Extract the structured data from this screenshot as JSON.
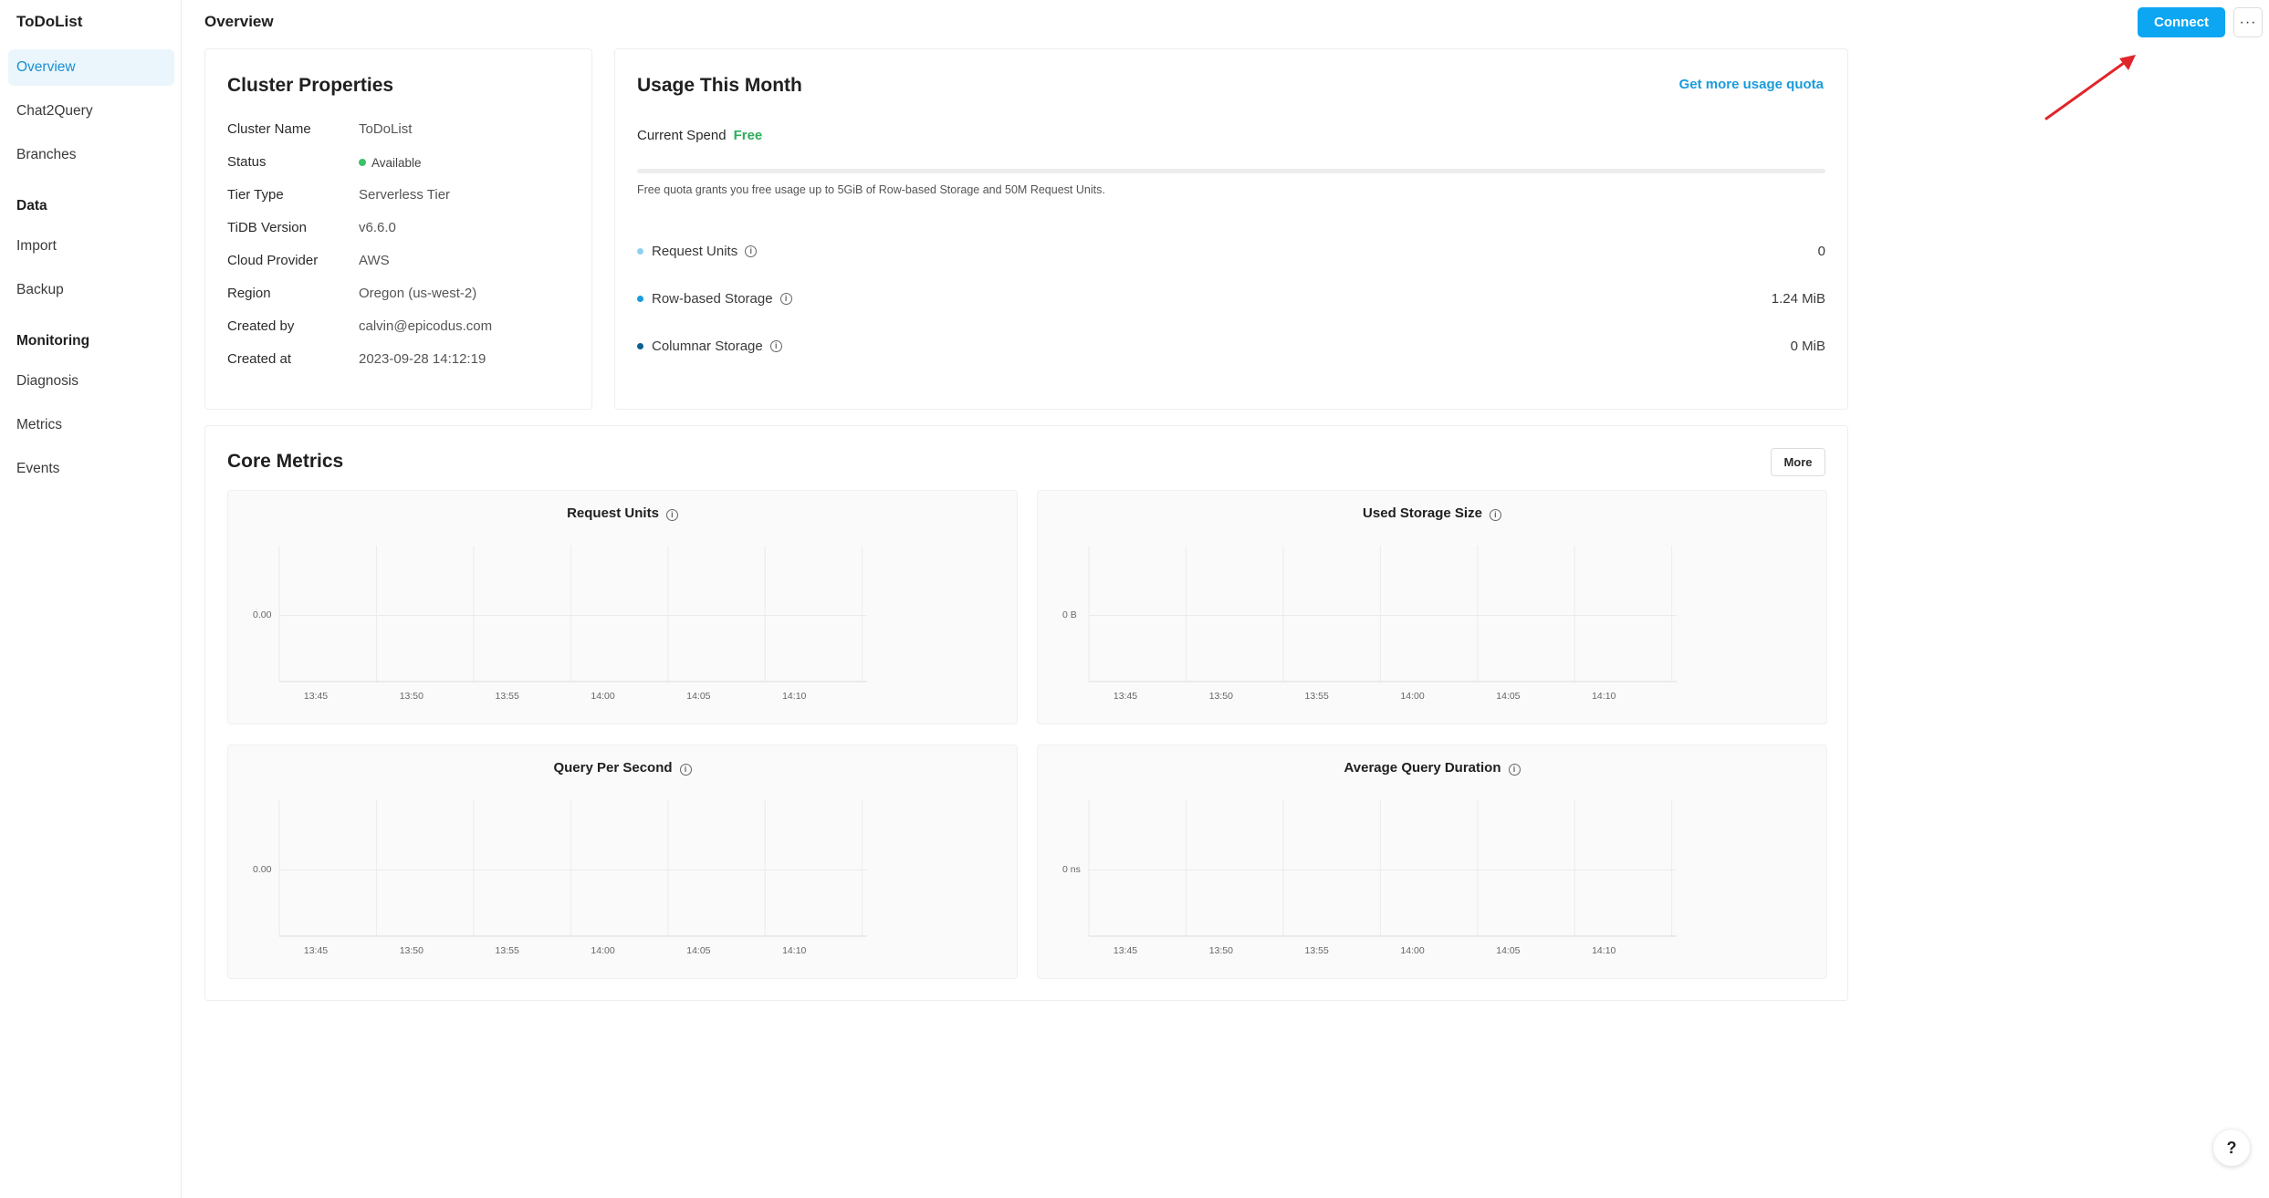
{
  "sidebar": {
    "app_title": "ToDoList",
    "items_top": [
      {
        "label": "Overview",
        "active": true
      },
      {
        "label": "Chat2Query"
      },
      {
        "label": "Branches"
      }
    ],
    "sections": [
      {
        "title": "Data",
        "items": [
          {
            "label": "Import"
          },
          {
            "label": "Backup"
          }
        ]
      },
      {
        "title": "Monitoring",
        "items": [
          {
            "label": "Diagnosis"
          },
          {
            "label": "Metrics"
          },
          {
            "label": "Events"
          }
        ]
      }
    ]
  },
  "header": {
    "title": "Overview",
    "connect_label": "Connect",
    "more_label": "···",
    "accent": "#0ca6f2"
  },
  "cluster": {
    "title": "Cluster Properties",
    "props": [
      {
        "label": "Cluster Name",
        "value": "ToDoList"
      },
      {
        "label": "Status",
        "value": "Available"
      },
      {
        "label": "Tier Type",
        "value": "Serverless Tier"
      },
      {
        "label": "TiDB Version",
        "value": "v6.6.0"
      },
      {
        "label": "Cloud Provider",
        "value": "AWS"
      },
      {
        "label": "Region",
        "value": "Oregon (us-west-2)"
      },
      {
        "label": "Created by",
        "value": "calvin@epicodus.com"
      },
      {
        "label": "Created at",
        "value": "2023-09-28 14:12:19"
      }
    ],
    "status_color": "#3dbf6b"
  },
  "usage": {
    "title": "Usage This Month",
    "quota_link": "Get more usage quota",
    "spend_label": "Current Spend",
    "spend_value": "Free",
    "progress_fraction": 0.0,
    "note": "Free quota grants you free usage up to 5GiB of Row-based Storage and 50M Request Units.",
    "rows": [
      {
        "label": "Request Units",
        "value": "0",
        "color": "#8fd0f2"
      },
      {
        "label": "Row-based Storage",
        "value": "1.24 MiB",
        "color": "#1a9bdc"
      },
      {
        "label": "Columnar Storage",
        "value": "0 MiB",
        "color": "#0b5f93"
      }
    ]
  },
  "metrics": {
    "title": "Core Metrics",
    "more_label": "More"
  },
  "chart_data": [
    {
      "type": "line",
      "title": "Request Units",
      "x": [
        "13:45",
        "13:50",
        "13:55",
        "14:00",
        "14:05",
        "14:10"
      ],
      "ytick": "0.00",
      "series": []
    },
    {
      "type": "line",
      "title": "Used Storage Size",
      "x": [
        "13:45",
        "13:50",
        "13:55",
        "14:00",
        "14:05",
        "14:10"
      ],
      "ytick": "0 B",
      "series": []
    },
    {
      "type": "line",
      "title": "Query Per Second",
      "x": [
        "13:45",
        "13:50",
        "13:55",
        "14:00",
        "14:05",
        "14:10"
      ],
      "ytick": "0.00",
      "series": []
    },
    {
      "type": "line",
      "title": "Average Query Duration",
      "x": [
        "13:45",
        "13:50",
        "13:55",
        "14:00",
        "14:05",
        "14:10"
      ],
      "ytick": "0 ns",
      "series": []
    }
  ],
  "help": {
    "label": "?"
  },
  "info_glyph": "i"
}
